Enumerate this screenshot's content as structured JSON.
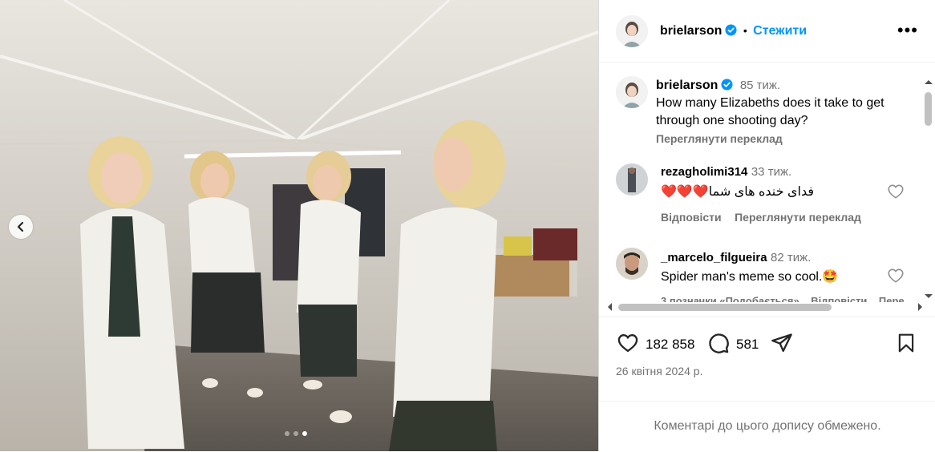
{
  "post_image": {
    "alt": "",
    "carousel_dots": 3,
    "active_dot": 2
  },
  "header": {
    "username": "brielarson",
    "separator": "•",
    "follow_label": "Стежити",
    "more_label": "•••"
  },
  "caption": {
    "username": "brielarson",
    "time": "85 тиж.",
    "text": "How many Elizabeths does it take to get through one shooting day?",
    "translate_label": "Переглянути переклад"
  },
  "comments": [
    {
      "username": "rezagholimi314",
      "time": "33 тиж.",
      "text": "❤️❤️❤️فدای خنده های شما",
      "reply_label": "Відповісти",
      "translate_label": "Переглянути переклад"
    },
    {
      "username": "_marcelo_filgueira",
      "time": "82 тиж.",
      "text": "Spider man's meme so cool.🤩",
      "likes_label": "3 позначки «Подобається»",
      "reply_label": "Відповісти",
      "translate_label": "Пере"
    }
  ],
  "actions": {
    "likes": "182 858",
    "comments": "581",
    "date": "26 квітня 2024 р."
  },
  "footer": {
    "limited_text": "Коментарі до цього допису обмежено."
  },
  "colors": {
    "accent": "#0095f6",
    "muted": "#737373",
    "border": "#dbdbdb"
  }
}
